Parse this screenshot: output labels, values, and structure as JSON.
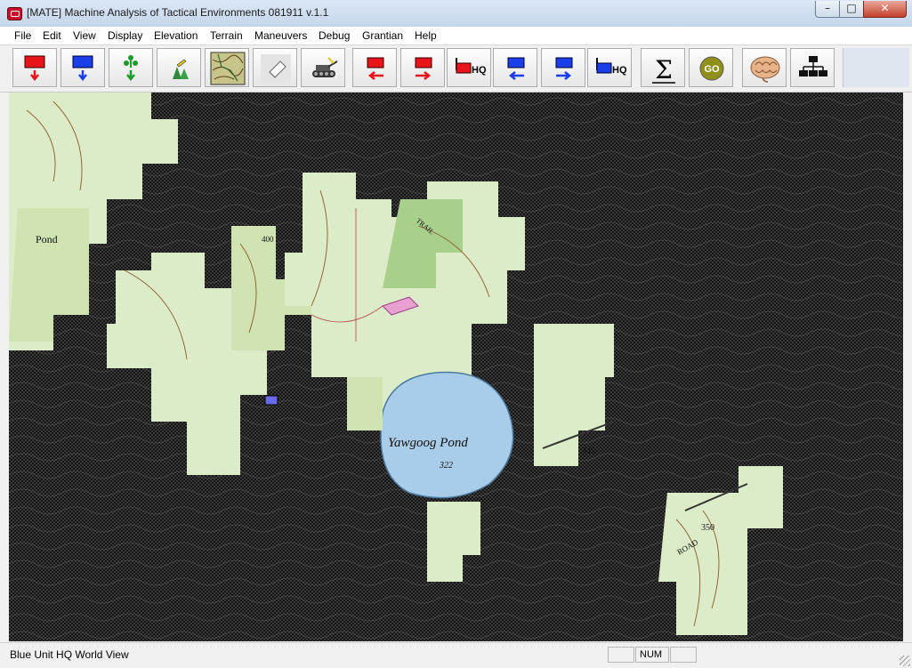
{
  "window": {
    "title": "[MATE] Machine Analysis of Tactical Environments  081911 v.1.1",
    "controls": {
      "minimize": "–",
      "maximize": "□",
      "close": "✕"
    }
  },
  "menu": {
    "items": [
      {
        "id": "file",
        "label": "File"
      },
      {
        "id": "edit",
        "label": "Edit"
      },
      {
        "id": "view",
        "label": "View"
      },
      {
        "id": "display",
        "label": "Display"
      },
      {
        "id": "elevation",
        "label": "Elevation"
      },
      {
        "id": "terrain",
        "label": "Terrain"
      },
      {
        "id": "maneuvers",
        "label": "Maneuvers"
      },
      {
        "id": "debug",
        "label": "Debug"
      },
      {
        "id": "grantian",
        "label": "Grantian"
      },
      {
        "id": "help",
        "label": "Help"
      }
    ]
  },
  "toolbar": {
    "buttons": [
      {
        "id": "red-unit-down",
        "icon": "red-unit-down-arrow-icon",
        "color": "#e8141a"
      },
      {
        "id": "blue-unit-down",
        "icon": "blue-unit-down-arrow-icon",
        "color": "#1a3ee8"
      },
      {
        "id": "green-down",
        "icon": "green-symbol-down-arrow-icon",
        "color": "#1a9a2a"
      },
      {
        "id": "trees",
        "icon": "trees-terrain-icon"
      },
      {
        "id": "map-image",
        "icon": "map-thumbnail-icon"
      },
      {
        "id": "eraser",
        "icon": "eraser-icon"
      },
      {
        "id": "tank",
        "icon": "tank-icon"
      },
      {
        "id": "red-unit-left",
        "icon": "red-unit-left-arrow-icon",
        "color": "#e8141a"
      },
      {
        "id": "red-unit-right",
        "icon": "red-unit-right-arrow-icon",
        "color": "#e8141a"
      },
      {
        "id": "red-hq",
        "icon": "red-hq-icon",
        "label": "HQ",
        "color": "#e8141a"
      },
      {
        "id": "blue-unit-left",
        "icon": "blue-unit-left-arrow-icon",
        "color": "#1a3ee8"
      },
      {
        "id": "blue-unit-right",
        "icon": "blue-unit-right-arrow-icon",
        "color": "#1a3ee8"
      },
      {
        "id": "blue-hq",
        "icon": "blue-hq-icon",
        "label": "HQ",
        "color": "#1a3ee8"
      },
      {
        "id": "sum",
        "icon": "sigma-icon",
        "label": "Σ"
      },
      {
        "id": "go",
        "icon": "go-icon",
        "label": "GO"
      },
      {
        "id": "brain",
        "icon": "brain-icon"
      },
      {
        "id": "hierarchy",
        "icon": "org-chart-icon"
      }
    ]
  },
  "map": {
    "labels": [
      {
        "id": "pond-left",
        "text": "Pond"
      },
      {
        "id": "yawgoog",
        "text": "Yawgoog  Pond"
      },
      {
        "id": "elev-322",
        "text": "322"
      },
      {
        "id": "elev-400",
        "text": "400"
      },
      {
        "id": "elev-345",
        "text": "345"
      },
      {
        "id": "elev-350",
        "text": "350"
      },
      {
        "id": "road",
        "text": "ROAD"
      },
      {
        "id": "trail",
        "text": "TRAIL"
      }
    ],
    "colors": {
      "terrain": "#dcebc8",
      "green": "#a9d08a",
      "water": "#a9cde8",
      "contour": "#8a5a2a",
      "fog": "#1c1c1c"
    }
  },
  "status": {
    "text": "Blue Unit HQ World View",
    "panels": [
      "",
      "NUM",
      ""
    ]
  }
}
